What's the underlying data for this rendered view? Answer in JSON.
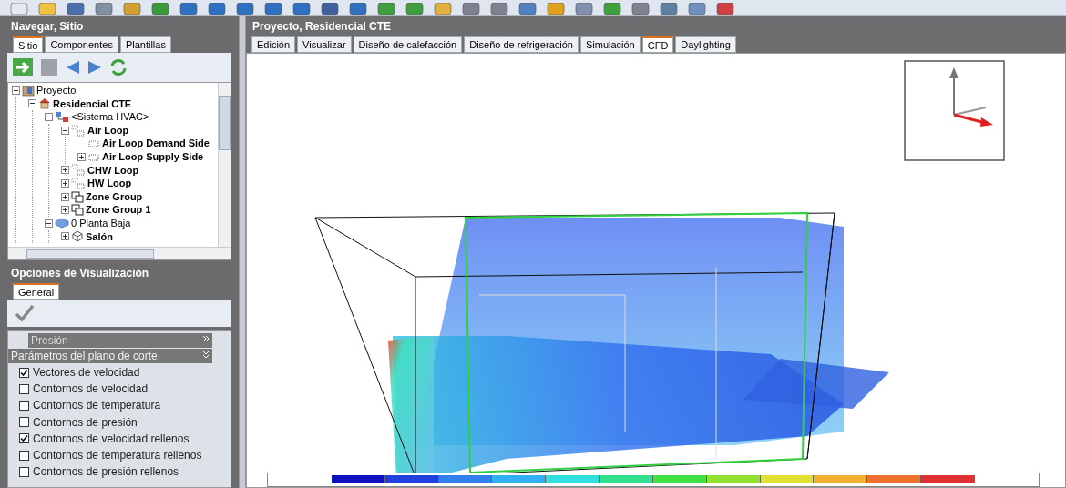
{
  "left_panel": {
    "title": "Navegar, Sitio",
    "tabs": [
      {
        "label": "Sitio",
        "selected": true
      },
      {
        "label": "Componentes",
        "selected": false
      },
      {
        "label": "Plantillas",
        "selected": false
      }
    ],
    "tree": [
      {
        "label": "Proyecto",
        "bold": false,
        "kind": "project",
        "expanded": true,
        "children": [
          {
            "label": "Residencial CTE",
            "bold": true,
            "kind": "building",
            "expanded": true,
            "children": [
              {
                "label": "<Sistema HVAC>",
                "bold": false,
                "kind": "hvac",
                "expanded": true,
                "children": [
                  {
                    "label": "Air Loop",
                    "bold": true,
                    "kind": "loop",
                    "expanded": true,
                    "children": [
                      {
                        "label": "Air Loop Demand Side",
                        "bold": true,
                        "kind": "side"
                      },
                      {
                        "label": "Air Loop Supply Side",
                        "bold": true,
                        "kind": "side",
                        "expanded": false
                      }
                    ]
                  },
                  {
                    "label": "CHW Loop",
                    "bold": true,
                    "kind": "loop",
                    "expanded": false
                  },
                  {
                    "label": "HW Loop",
                    "bold": true,
                    "kind": "loop",
                    "expanded": false
                  },
                  {
                    "label": "Zone Group",
                    "bold": true,
                    "kind": "group",
                    "expanded": false
                  },
                  {
                    "label": "Zone Group 1",
                    "bold": true,
                    "kind": "group",
                    "expanded": false
                  }
                ]
              },
              {
                "label": "0 Planta Baja",
                "bold": false,
                "kind": "floor",
                "expanded": true,
                "children": [
                  {
                    "label": "Salón",
                    "bold": true,
                    "kind": "zone",
                    "expanded": false
                  }
                ]
              }
            ]
          }
        ]
      }
    ]
  },
  "options_panel": {
    "title": "Opciones de Visualización",
    "tabs": [
      {
        "label": "General",
        "selected": true
      }
    ],
    "groups": [
      {
        "label": "Presión",
        "expanded": false
      },
      {
        "label": "Parámetros del plano de corte",
        "expanded": true
      }
    ],
    "options": [
      {
        "label": "Vectores de velocidad",
        "checked": true
      },
      {
        "label": "Contornos de velocidad",
        "checked": false
      },
      {
        "label": "Contornos de temperatura",
        "checked": false
      },
      {
        "label": "Contornos de presión",
        "checked": false
      },
      {
        "label": "Contornos de velocidad rellenos",
        "checked": true
      },
      {
        "label": "Contornos de temperatura rellenos",
        "checked": false
      },
      {
        "label": "Contornos de presión rellenos",
        "checked": false
      }
    ]
  },
  "main": {
    "title": "Proyecto, Residencial CTE",
    "tabs": [
      {
        "label": "Edición",
        "selected": false
      },
      {
        "label": "Visualizar",
        "selected": false
      },
      {
        "label": "Diseño de calefacción",
        "selected": false
      },
      {
        "label": "Diseño de refrigeración",
        "selected": false
      },
      {
        "label": "Simulación",
        "selected": false
      },
      {
        "label": "CFD",
        "selected": true
      },
      {
        "label": "Daylighting",
        "selected": false
      }
    ]
  }
}
